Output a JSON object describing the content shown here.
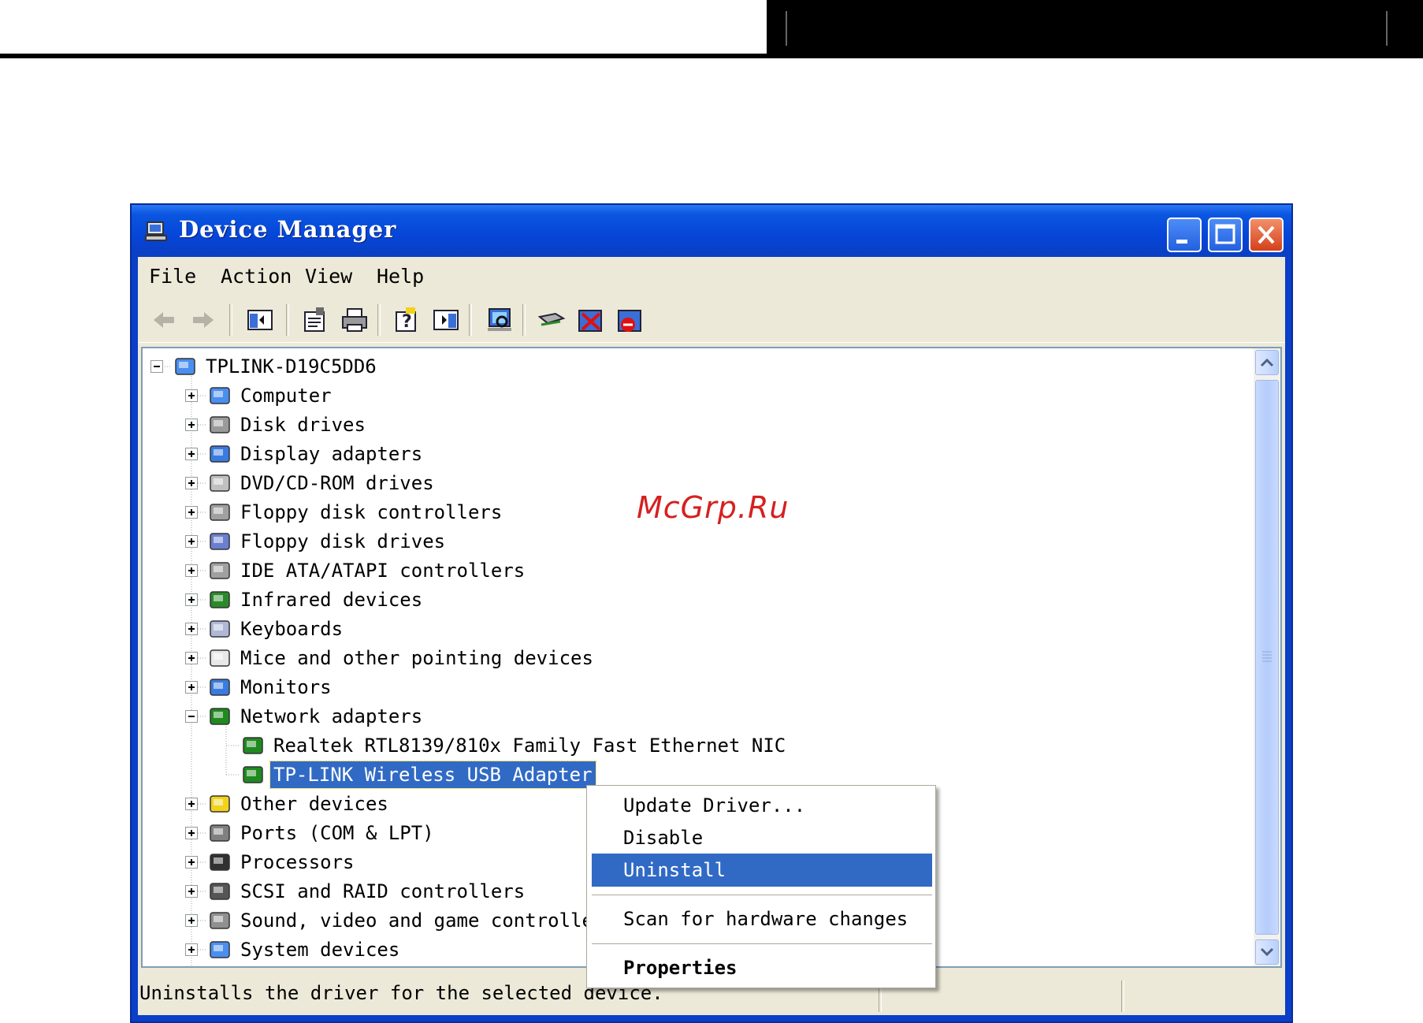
{
  "window": {
    "title": "Device Manager"
  },
  "menu": [
    "File",
    "Action",
    "View",
    "Help"
  ],
  "tree": {
    "root": "TPLINK-D19C5DD6",
    "items": [
      {
        "label": "Computer",
        "icon": "computer-icon"
      },
      {
        "label": "Disk drives",
        "icon": "disk-drive-icon"
      },
      {
        "label": "Display adapters",
        "icon": "display-adapter-icon"
      },
      {
        "label": "DVD/CD-ROM drives",
        "icon": "cdrom-icon"
      },
      {
        "label": "Floppy disk controllers",
        "icon": "controller-icon"
      },
      {
        "label": "Floppy disk drives",
        "icon": "floppy-icon"
      },
      {
        "label": "IDE ATA/ATAPI controllers",
        "icon": "controller-icon"
      },
      {
        "label": "Infrared devices",
        "icon": "infrared-icon"
      },
      {
        "label": "Keyboards",
        "icon": "keyboard-icon"
      },
      {
        "label": "Mice and other pointing devices",
        "icon": "mouse-icon"
      },
      {
        "label": "Monitors",
        "icon": "monitor-icon"
      },
      {
        "label": "Network adapters",
        "icon": "network-adapter-icon",
        "expanded": true
      },
      {
        "label": "Realtek RTL8139/810x Family Fast Ethernet NIC",
        "icon": "network-card-icon",
        "child": true
      },
      {
        "label": "TP-LINK Wireless USB Adapter",
        "icon": "network-card-icon",
        "child": true,
        "selected": true
      },
      {
        "label": "Other devices",
        "icon": "unknown-device-icon"
      },
      {
        "label": "Ports (COM & LPT)",
        "icon": "port-icon"
      },
      {
        "label": "Processors",
        "icon": "processor-icon"
      },
      {
        "label": "SCSI and RAID controllers",
        "icon": "scsi-icon"
      },
      {
        "label": "Sound, video and game controllers",
        "icon": "sound-icon"
      },
      {
        "label": "System devices",
        "icon": "system-device-icon"
      }
    ]
  },
  "context_menu": {
    "items": [
      "Update Driver...",
      "Disable",
      "Uninstall",
      "Scan for hardware changes",
      "Properties"
    ],
    "highlighted": "Uninstall"
  },
  "status": {
    "text": "Uninstalls the driver for the selected device."
  },
  "watermark": "McGrp.Ru",
  "colors": {
    "titlebar": "#0645d8",
    "selection": "#316ac5",
    "face": "#ece9d8",
    "watermark": "#d62020"
  }
}
